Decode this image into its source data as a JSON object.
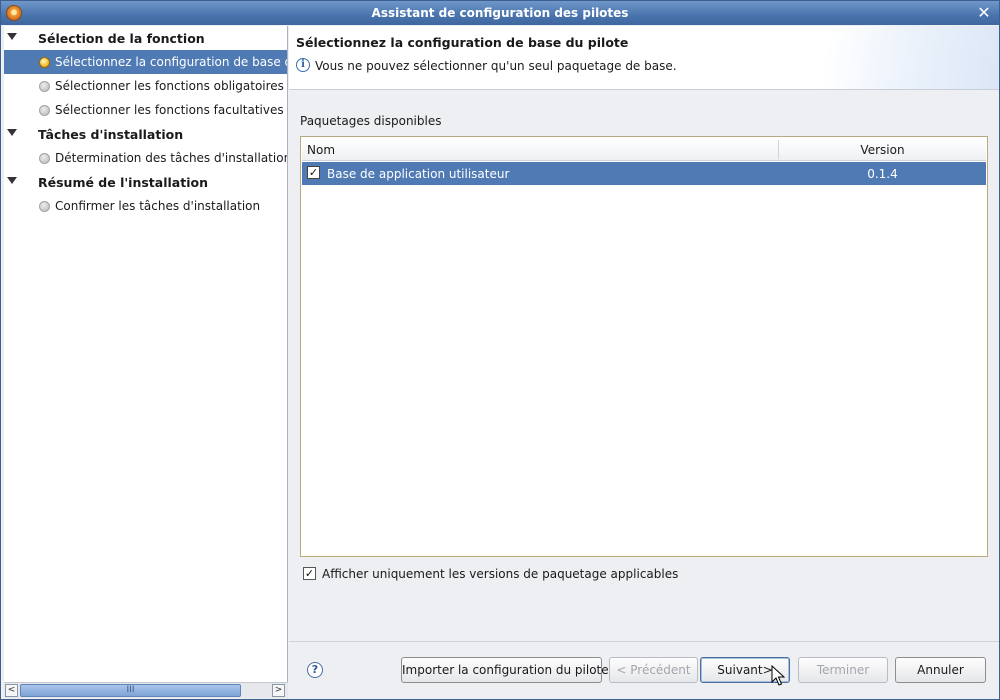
{
  "window": {
    "title": "Assistant de configuration des pilotes",
    "close_symbol": "✕"
  },
  "tree": {
    "sections": [
      {
        "label": "Sélection de la fonction",
        "items": [
          {
            "label": "Sélectionnez la configuration de base du pilote",
            "selected": true
          },
          {
            "label": "Sélectionner les fonctions obligatoires",
            "selected": false
          },
          {
            "label": "Sélectionner les fonctions facultatives",
            "selected": false
          }
        ]
      },
      {
        "label": "Tâches d'installation",
        "items": [
          {
            "label": "Détermination des tâches d'installation...",
            "selected": false
          }
        ]
      },
      {
        "label": "Résumé de l'installation",
        "items": [
          {
            "label": "Confirmer les tâches d'installation",
            "selected": false
          }
        ]
      }
    ],
    "scrollbar": {
      "left_arrow": "<",
      "right_arrow": ">",
      "grip": "III"
    }
  },
  "header": {
    "title": "Sélectionnez la configuration de base du pilote",
    "info_symbol": "i",
    "message": "Vous ne pouvez sélectionner qu'un seul paquetage de base."
  },
  "packages": {
    "label": "Paquetages disponibles",
    "columns": {
      "name": "Nom",
      "version": "Version"
    },
    "rows": [
      {
        "checked": true,
        "name": "Base de application utilisateur",
        "version": "0.1.4"
      }
    ]
  },
  "options": {
    "only_applicable_label": "Afficher uniquement les versions de paquetage applicables",
    "only_applicable_checked": true,
    "check_symbol": "✓"
  },
  "footer": {
    "help_symbol": "?",
    "import_label": "Importer la configuration du pilote",
    "back_label": "< Précédent",
    "next_label": "Suivant>",
    "finish_label": "Terminer",
    "cancel_label": "Annuler"
  },
  "colors": {
    "selection": "#4f7ab4",
    "titlebar": "#4a74ad"
  }
}
